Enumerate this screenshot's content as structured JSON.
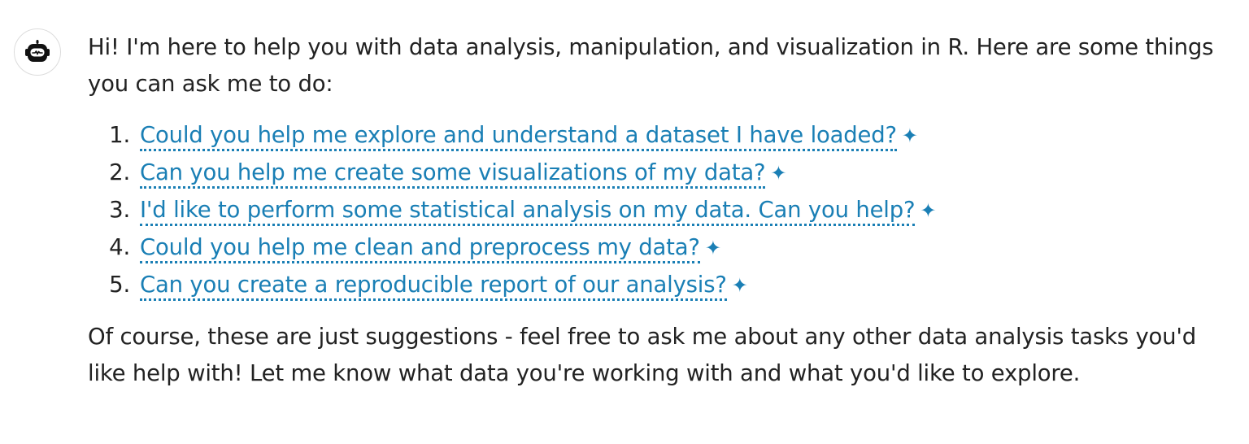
{
  "assistant": {
    "avatar_icon": "robot-icon",
    "intro_text": "Hi! I'm here to help you with data analysis, manipulation, and visualization in R. Here are some things you can ask me to do:",
    "suggestions": [
      {
        "number": "1.",
        "text": "Could you help me explore and understand a dataset I have loaded?",
        "icon": "✦"
      },
      {
        "number": "2.",
        "text": "Can you help me create some visualizations of my data?",
        "icon": "✦"
      },
      {
        "number": "3.",
        "text": "I'd like to perform some statistical analysis on my data. Can you help?",
        "icon": "✦"
      },
      {
        "number": "4.",
        "text": "Could you help me clean and preprocess my data?",
        "icon": "✦"
      },
      {
        "number": "5.",
        "text": "Can you create a reproducible report of our analysis?",
        "icon": "✦"
      }
    ],
    "outro_text": "Of course, these are just suggestions - feel free to ask me about any other data analysis tasks you'd like help with! Let me know what data you're working with and what you'd like to explore."
  },
  "colors": {
    "link": "#1a7fb5",
    "text": "#222222",
    "avatar_border": "#dcdcdc"
  }
}
